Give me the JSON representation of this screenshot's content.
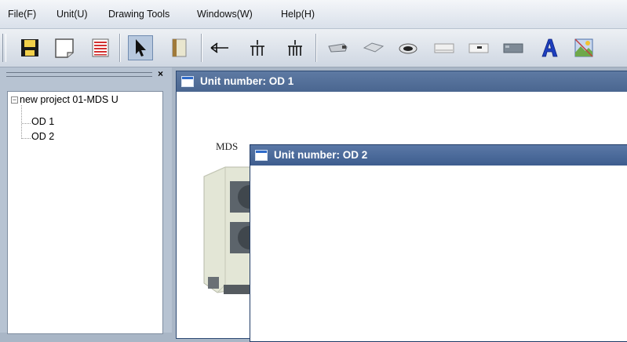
{
  "menu": {
    "items": [
      "File(F)",
      "Unit(U)",
      "Drawing Tools",
      "Windows(W)",
      "Help(H)"
    ]
  },
  "toolbar": {
    "buttons": [
      "save-icon",
      "new-page-icon",
      "report-icon",
      "pointer-icon",
      "outdoor-unit-icon",
      "branch-joint-icon",
      "header-joint-icon",
      "header-joint-2-icon",
      "duct-unit-icon",
      "cassette-unit-icon",
      "round-cassette-icon",
      "wall-mounted-icon",
      "ceiling-unit-icon",
      "floor-unit-icon",
      "text-tool-icon",
      "picture-tool-icon"
    ]
  },
  "tree": {
    "root_label": "new project 01-MDS U",
    "children": [
      "OD 1",
      "OD 2"
    ],
    "close_label": "×"
  },
  "windows": {
    "od1_title": "Unit number: OD 1",
    "od2_title": "Unit number: OD 2",
    "unit_label": "MDS"
  },
  "colors": {
    "title_bar": "#4b6690",
    "workspace": "#a9b6c6",
    "unit_body": "#e3e6d6"
  }
}
